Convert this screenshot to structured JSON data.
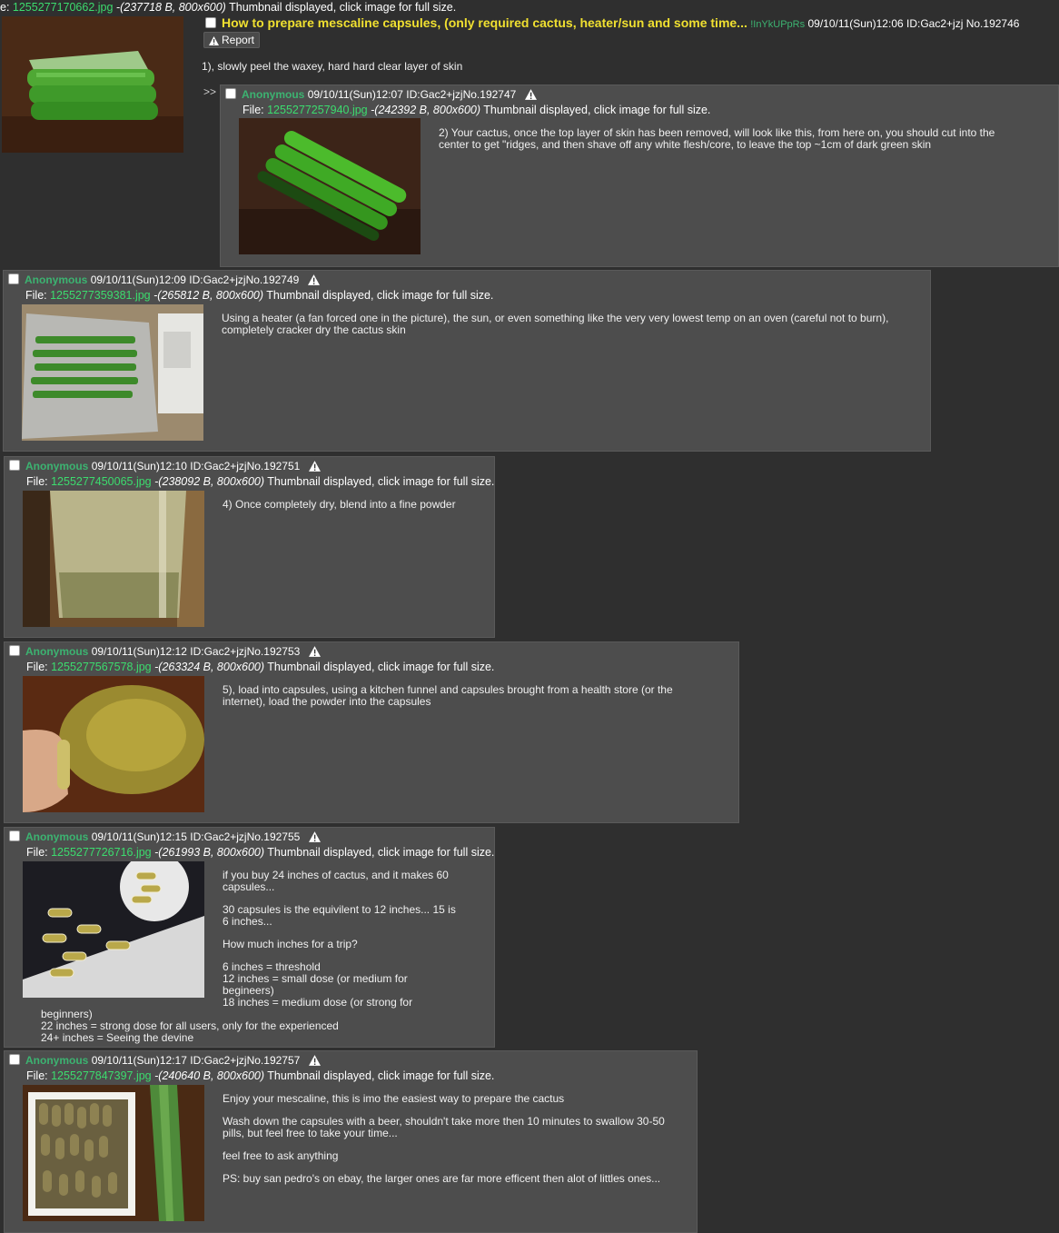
{
  "op": {
    "file_prefix": "e: ",
    "filename": "1255277170662.jpg",
    "filesize": "(237718 B, 800x600)",
    "thumb_note": "Thumbnail displayed, click image for full size.",
    "subject": "How to prepare mescaline capsules, (only required cactus, heater/sun and some time...",
    "tripcode": "!InYkUPpRs",
    "datetime": "09/10/11(Sun)12:06",
    "id": "ID:Gac2+jzj",
    "no": "No.192746",
    "report_label": "Report",
    "body": "1), slowly peel the waxey, hard hard clear layer of skin",
    "thumb_icon": "peeled-cactus-photo"
  },
  "reply_marker": ">>",
  "replies": [
    {
      "name": "Anonymous",
      "datetime": "09/10/11(Sun)12:07",
      "id": "ID:Gac2+jzj",
      "no": "No.192747",
      "file_label": "File:",
      "filename": "1255277257940.jpg",
      "filesize": "-(242392 B, 800x600)",
      "thumb_note": "Thumbnail displayed, click image for full size.",
      "body": [
        "2) Your cactus, once the top layer of skin has been removed, will look like this, from here on, you should cut into the center to get \"ridges, and then shave off any white flesh/core, to leave the top ~1cm of dark green skin"
      ]
    },
    {
      "name": "Anonymous",
      "datetime": "09/10/11(Sun)12:09",
      "id": "ID:Gac2+jzj",
      "no": "No.192749",
      "file_label": "File:",
      "filename": "1255277359381.jpg",
      "filesize": "-(265812 B, 800x600)",
      "thumb_note": "Thumbnail displayed, click image for full size.",
      "body": [
        "Using a heater (a fan forced one in the picture), the sun, or even something like the very very lowest temp on an oven (careful not to burn), completely cracker dry the cactus skin"
      ]
    },
    {
      "name": "Anonymous",
      "datetime": "09/10/11(Sun)12:10",
      "id": "ID:Gac2+jzj",
      "no": "No.192751",
      "file_label": "File:",
      "filename": "1255277450065.jpg",
      "filesize": "-(238092 B, 800x600)",
      "thumb_note": "Thumbnail displayed, click image for full size.",
      "body": [
        "4) Once completely dry, blend into a fine powder"
      ]
    },
    {
      "name": "Anonymous",
      "datetime": "09/10/11(Sun)12:12",
      "id": "ID:Gac2+jzj",
      "no": "No.192753",
      "file_label": "File:",
      "filename": "1255277567578.jpg",
      "filesize": "-(263324 B, 800x600)",
      "thumb_note": "Thumbnail displayed, click image for full size.",
      "body": [
        "5), load into capsules, using a kitchen funnel and capsules brought from a health store (or the internet), load the powder into the capsules"
      ]
    },
    {
      "name": "Anonymous",
      "datetime": "09/10/11(Sun)12:15",
      "id": "ID:Gac2+jzj",
      "no": "No.192755",
      "file_label": "File:",
      "filename": "1255277726716.jpg",
      "filesize": "-(261993 B, 800x600)",
      "thumb_note": "Thumbnail displayed, click image for full size.",
      "body": [
        "if you buy 24 inches of cactus, and it makes 60 capsules...",
        "30 capsules is the equivilent to 12 inches... 15 is 6 inches...",
        "How much inches for a trip?",
        "6 inches = threshold",
        "12 inches = small dose (or medium for begineers)",
        "18 inches = medium dose (or strong for",
        "beginners)",
        "22 inches = strong dose for all users, only for the experienced",
        "24+ inches = Seeing the devine"
      ]
    },
    {
      "name": "Anonymous",
      "datetime": "09/10/11(Sun)12:17",
      "id": "ID:Gac2+jzj",
      "no": "No.192757",
      "file_label": "File:",
      "filename": "1255277847397.jpg",
      "filesize": "-(240640 B, 800x600)",
      "thumb_note": "Thumbnail displayed, click image for full size.",
      "body": [
        "Enjoy your mescaline, this is imo the easiest way to prepare the cactus",
        "Wash down the capsules with a beer, shouldn't take more then 10 minutes to swallow 30-50 pills, but feel free to take your time...",
        "feel free to ask anything",
        "PS: buy san pedro's on ebay, the larger ones are far more efficent then alot of littles ones..."
      ]
    }
  ]
}
